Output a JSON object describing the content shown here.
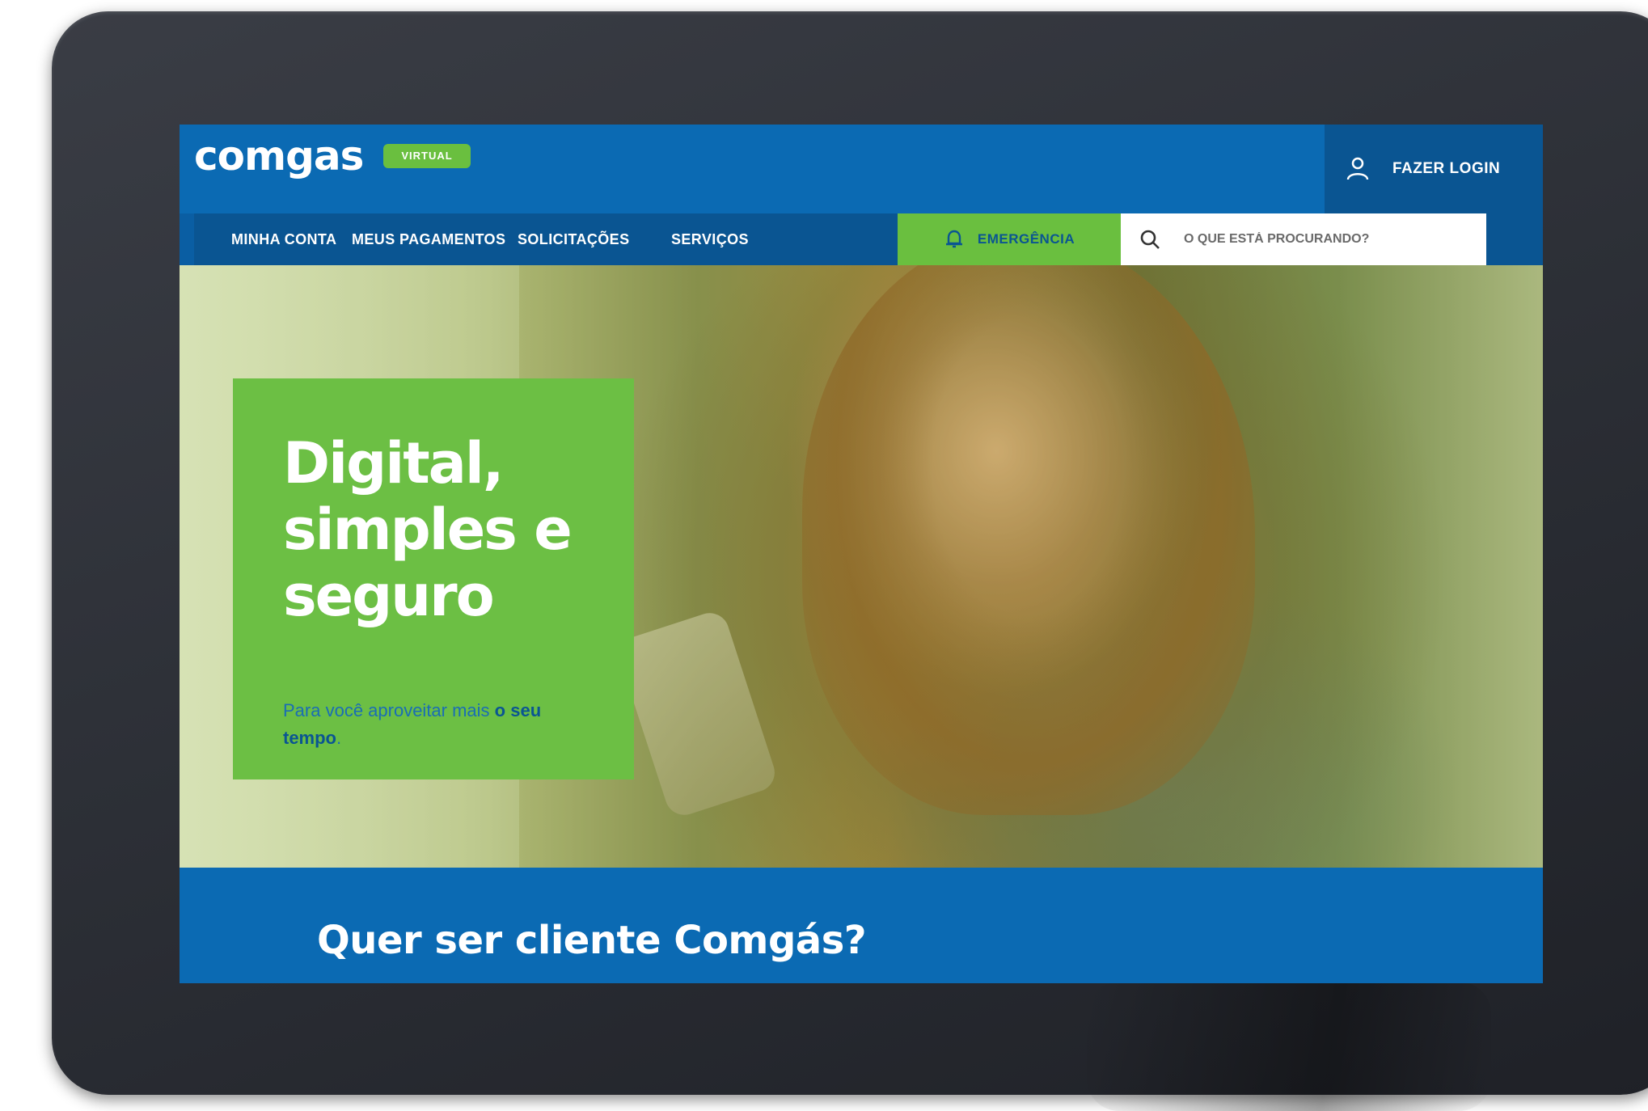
{
  "header": {
    "logo_text": "comgas",
    "badge": "VIRTUAL",
    "login_label": "FAZER LOGIN"
  },
  "nav": {
    "items": [
      {
        "label": "MINHA CONTA"
      },
      {
        "label": "MEUS PAGAMENTOS"
      },
      {
        "label": "SOLICITAÇÕES"
      },
      {
        "label": "SERVIÇOS"
      }
    ],
    "emergency_label": "EMERGÊNCIA",
    "search_placeholder": "O QUE ESTÁ PROCURANDO?"
  },
  "hero": {
    "title": "Digital, simples e seguro",
    "subtitle_prefix": "Para você aproveitar mais ",
    "subtitle_bold": "o seu tempo",
    "subtitle_suffix": "."
  },
  "cta": {
    "title": "Quer ser cliente Comgás?"
  },
  "colors": {
    "brand_blue": "#0b6ab3",
    "nav_blue": "#0a5592",
    "brand_green": "#6cbf44"
  }
}
